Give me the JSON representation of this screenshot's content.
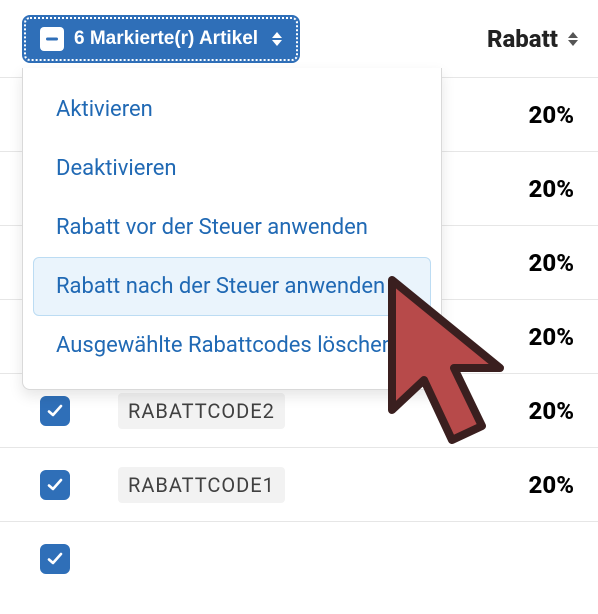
{
  "header": {
    "bulk_label": "6 Markierte(r) Artikel",
    "rabatt_label": "Rabatt"
  },
  "dropdown": {
    "items": [
      {
        "label": "Aktivieren"
      },
      {
        "label": "Deaktivieren"
      },
      {
        "label": "Rabatt vor der Steuer anwenden"
      },
      {
        "label": "Rabatt nach der Steuer anwenden"
      },
      {
        "label": "Ausgewählte Rabattcodes löschen"
      }
    ],
    "hover_index": 3
  },
  "rows": [
    {
      "code": "",
      "pct": "20%"
    },
    {
      "code": "",
      "pct": "20%"
    },
    {
      "code": "",
      "pct": "20%"
    },
    {
      "code": "",
      "pct": "20%"
    },
    {
      "code": "RABATTCODE2",
      "pct": "20%"
    },
    {
      "code": "RABATTCODE1",
      "pct": "20%"
    },
    {
      "code": "",
      "pct": ""
    }
  ]
}
